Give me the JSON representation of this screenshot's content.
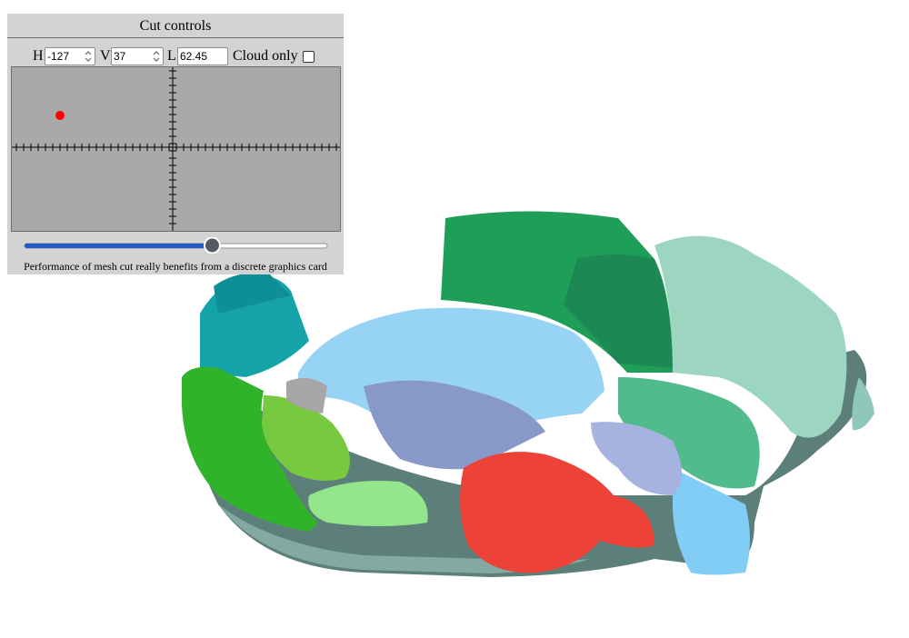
{
  "panel": {
    "title": "Cut controls",
    "h_label": "H",
    "h_value": "-127",
    "v_label": "V",
    "v_value": "37",
    "l_label": "L",
    "l_value": "62.45",
    "cloud_label": "Cloud only",
    "cloud_checked": false,
    "slider_value": 0.62,
    "caption": "Performance of mesh cut really benefits from a discrete graphics card"
  },
  "colors": {
    "panel_bg": "#d3d3d3",
    "pad_bg": "#a9a9a9",
    "slider_fill": "#1e5bc6",
    "slider_thumb": "#555a62",
    "marker": "#ff0000"
  }
}
